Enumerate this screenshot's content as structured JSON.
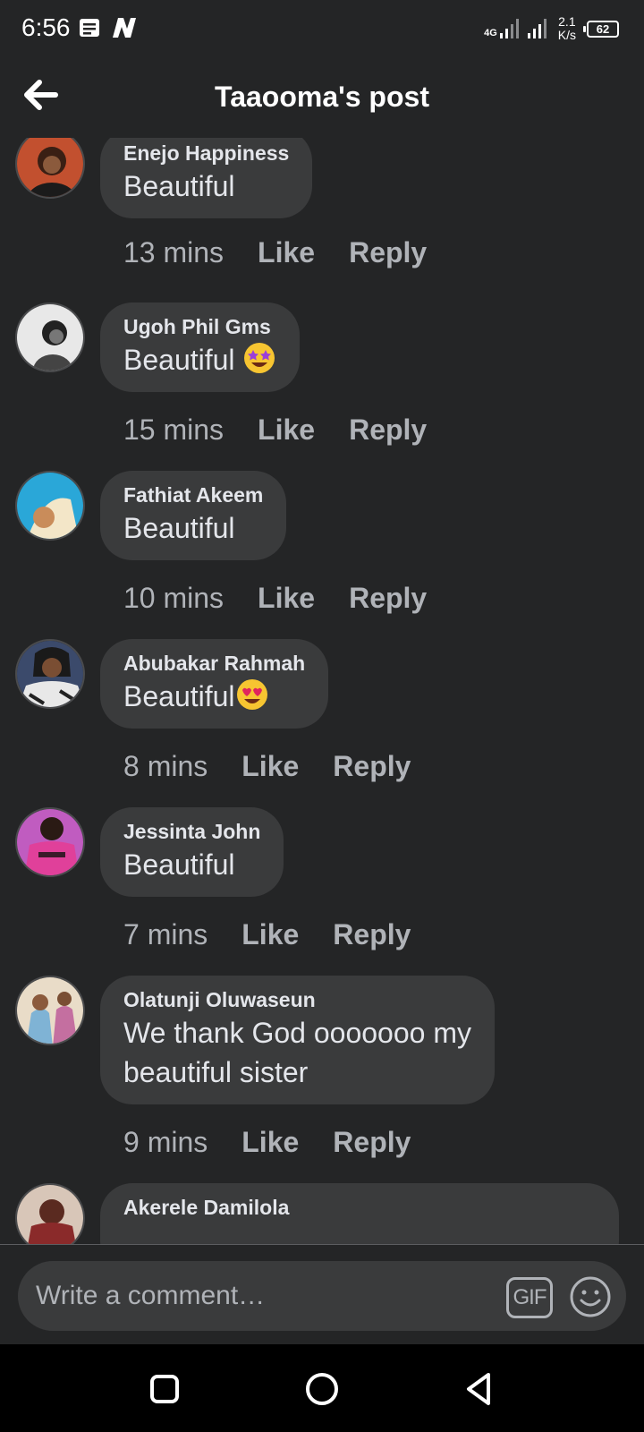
{
  "status_bar": {
    "time": "6:56",
    "network": "4G",
    "speed": "2.1",
    "speed_unit": "K/s",
    "battery": "62"
  },
  "header": {
    "title": "Taaooma's post"
  },
  "comments": [
    {
      "author": "Enejo Happiness",
      "text": "Beautiful",
      "emoji": "",
      "time": "13 mins",
      "like": "Like",
      "reply": "Reply",
      "avatar_color": "#c2502f"
    },
    {
      "author": "Ugoh Phil Gms",
      "text": "Beautiful ",
      "emoji": "star-struck-emoji",
      "time": "15 mins",
      "like": "Like",
      "reply": "Reply",
      "avatar_color": "#d9d9d9"
    },
    {
      "author": "Fathiat Akeem",
      "text": "Beautiful",
      "emoji": "",
      "time": "10 mins",
      "like": "Like",
      "reply": "Reply",
      "avatar_color": "#2aa7d8"
    },
    {
      "author": "Abubakar Rahmah",
      "text": "Beautiful",
      "emoji": "heart-eyes-emoji",
      "time": "8 mins",
      "like": "Like",
      "reply": "Reply",
      "avatar_color": "#3b4a6b"
    },
    {
      "author": "Jessinta John",
      "text": "Beautiful",
      "emoji": "",
      "time": "7 mins",
      "like": "Like",
      "reply": "Reply",
      "avatar_color": "#e0409a"
    },
    {
      "author": "Olatunji Oluwaseun",
      "text_line1": "We thank God ooooooo my",
      "text_line2": "beautiful sister",
      "time": "9 mins",
      "like": "Like",
      "reply": "Reply",
      "avatar_color": "#cfa98a"
    },
    {
      "author": "Akerele Damilola",
      "avatar_color": "#8a2a2a"
    }
  ],
  "composer": {
    "placeholder": "Write a comment…",
    "gif_label": "GIF"
  },
  "colors": {
    "background": "#242526",
    "bubble": "#3a3b3c",
    "secondary_text": "#b0b3b8"
  }
}
